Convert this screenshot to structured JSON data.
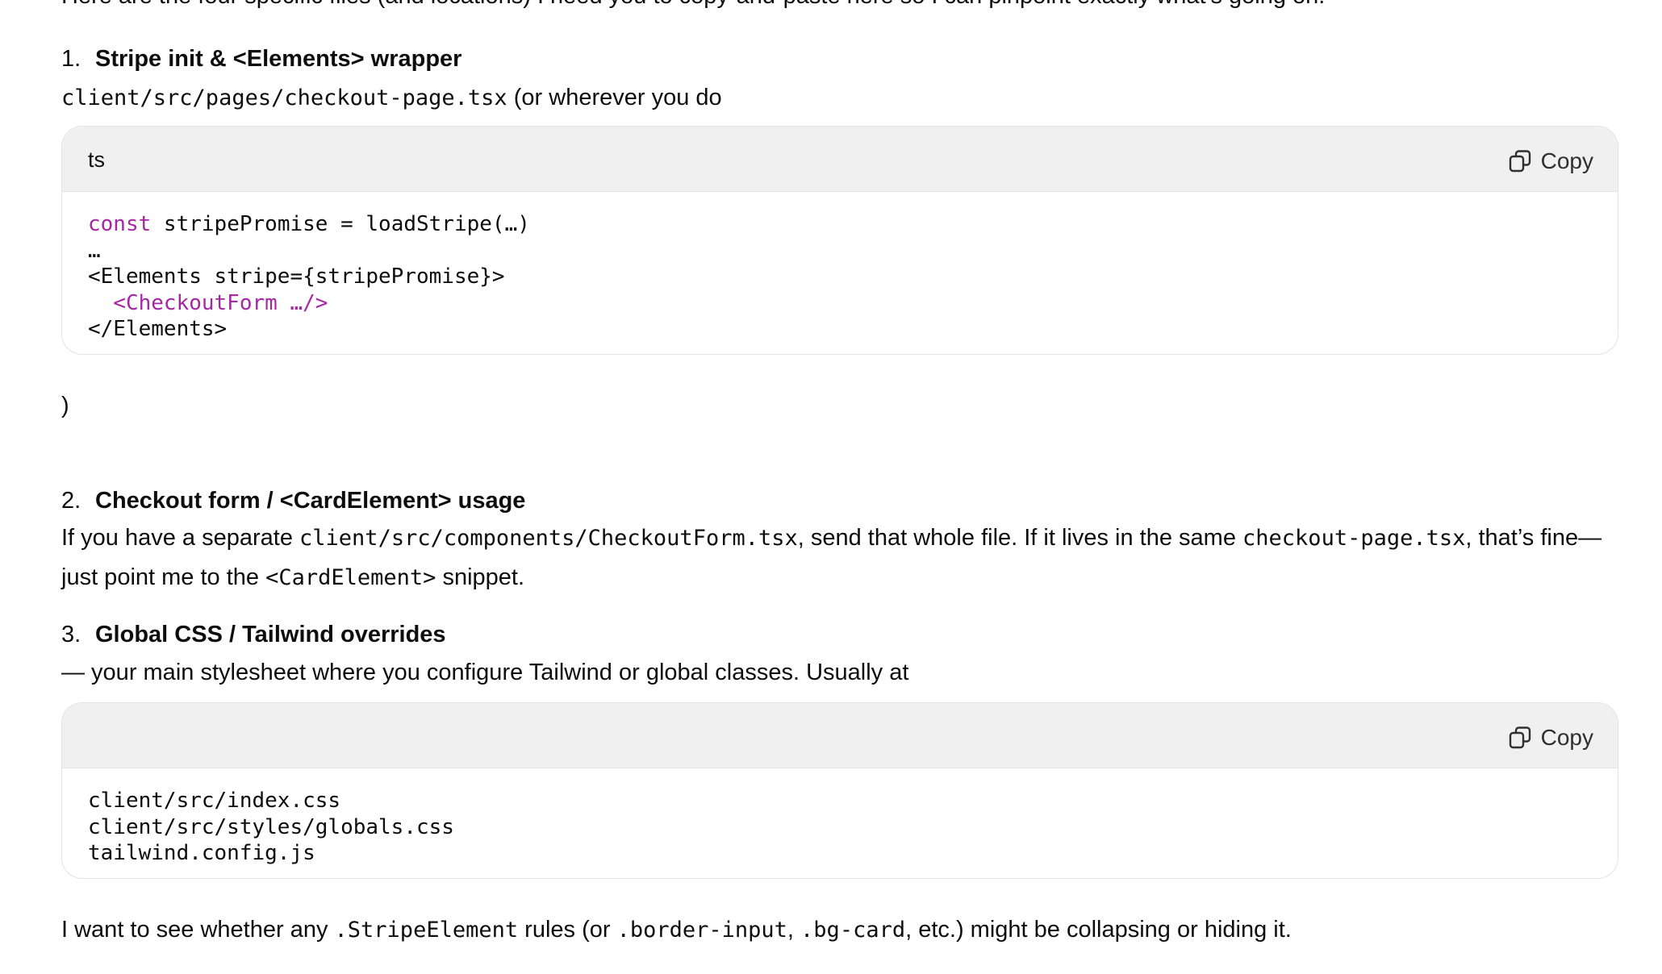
{
  "intro": "Here are the four specific files (and locations) I need you to copy-and-paste here so I can pinpoint exactly what’s going on.",
  "colors": {
    "keyword": "#a626a4",
    "code_header_bg": "#f0f0f0",
    "text": "#0d0d0d"
  },
  "sections": [
    {
      "number": "1.",
      "title": "Stripe init & <Elements> wrapper",
      "path": "client/src/pages/checkout-page.tsx",
      "path_suffix": " (or wherever you do",
      "code": {
        "lang": "ts",
        "copy_label": "Copy",
        "line1_kw": "const",
        "line1_rest": " stripePromise = loadStripe(…)",
        "line2": "…",
        "line3": "<Elements stripe={stripePromise}>",
        "line4": "  <CheckoutForm …/>",
        "line5": "</Elements>"
      },
      "after": ")"
    },
    {
      "number": "2.",
      "title": "Checkout form / <CardElement> usage",
      "text_a": "If you have a separate ",
      "code_a": "client/src/components/CheckoutForm.tsx",
      "text_b": ", send that whole file. If it lives in the same ",
      "code_b": "checkout-page.tsx",
      "text_c": ", that’s fine—just point me to the ",
      "code_c": "<CardElement>",
      "text_d": " snippet."
    },
    {
      "number": "3.",
      "title": "Global CSS / Tailwind overrides",
      "desc": "— your main stylesheet where you configure Tailwind or global classes. Usually at",
      "code": {
        "lang": "",
        "copy_label": "Copy",
        "lines": [
          "client/src/index.css",
          "client/src/styles/globals.css",
          "tailwind.config.js"
        ]
      }
    }
  ],
  "closing": {
    "text_a": "I want to see whether any ",
    "code_a": ".StripeElement",
    "text_b": " rules (or ",
    "code_b": ".border-input",
    "text_c": ", ",
    "code_c": ".bg-card",
    "text_d": ", etc.) might be collapsing or hiding it."
  }
}
